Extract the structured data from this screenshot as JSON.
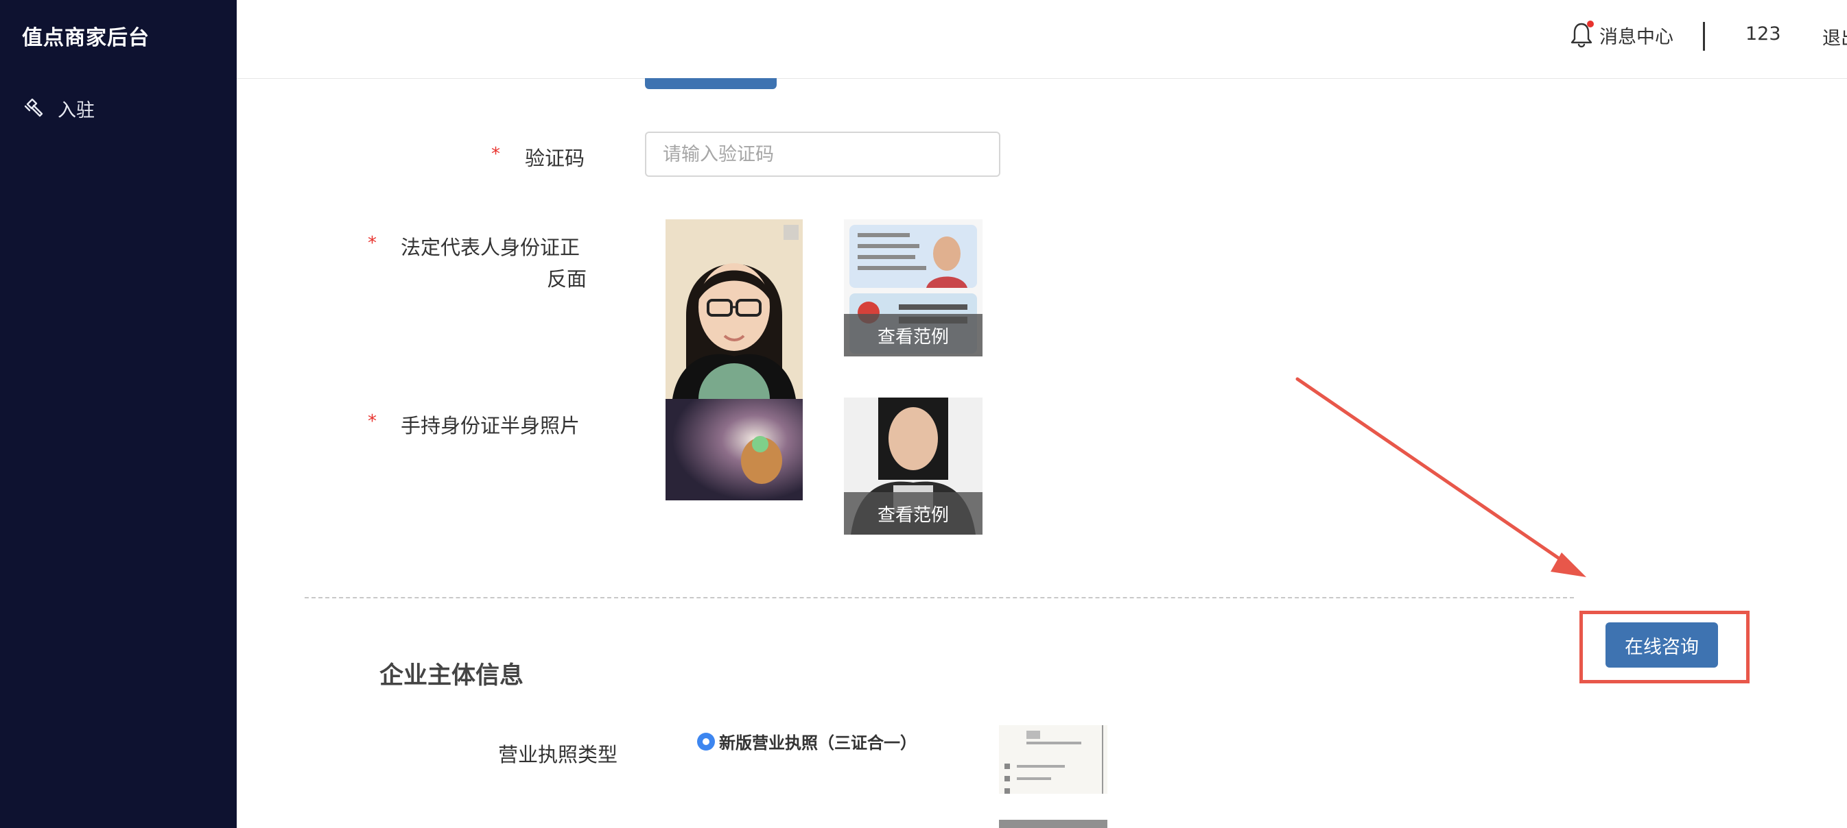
{
  "sidebar": {
    "brand": "值点商家后台",
    "items": [
      {
        "label": "入驻",
        "icon": "hammer-icon"
      }
    ]
  },
  "header": {
    "message_center": "消息中心",
    "username": "123",
    "logout": "退出"
  },
  "form": {
    "captcha": {
      "label": "验证码",
      "required": "*",
      "placeholder": "请输入验证码"
    },
    "id_back": {
      "label_line1": "法定代表人身份证正",
      "label_line2": "反面",
      "required": "*",
      "sample_label": "查看范例"
    },
    "handheld": {
      "label": "手持身份证半身照片",
      "required": "*",
      "sample_label": "查看范例"
    }
  },
  "enterprise": {
    "title": "企业主体信息",
    "license_type_label": "营业执照类型",
    "license_option": "新版营业执照（三证合一）",
    "consult_button": "在线咨询"
  },
  "colors": {
    "sidebar_bg": "#0e1230",
    "primary": "#3e73b1",
    "required": "#e8332e",
    "annotation": "#e8574a",
    "radio": "#3d86f0"
  }
}
